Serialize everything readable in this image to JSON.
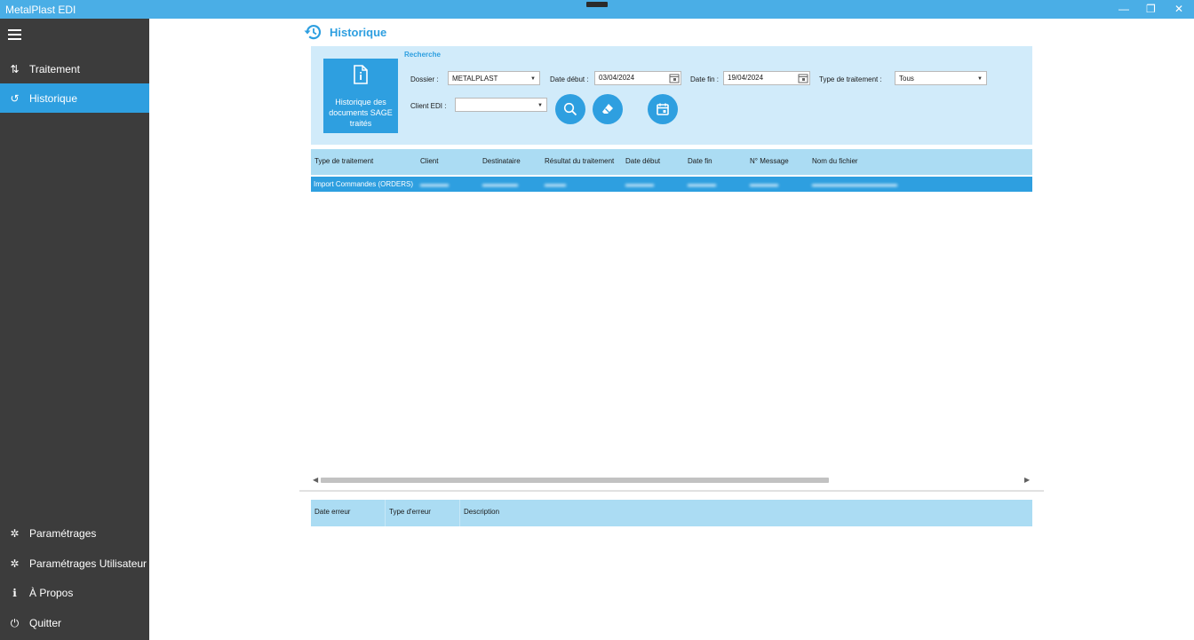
{
  "window": {
    "title": "MetalPlast EDI",
    "minimize_glyph": "—",
    "restore_glyph": "❐",
    "close_glyph": "✕"
  },
  "sidebar": {
    "menu_icon": "hamburger-icon",
    "items": [
      {
        "label": "Traitement",
        "icon": "sort-arrows-icon",
        "glyph": "⇅",
        "active": false
      },
      {
        "label": "Historique",
        "icon": "history-icon",
        "glyph": "↺",
        "active": true
      }
    ],
    "bottom_items": [
      {
        "label": "Paramétrages",
        "icon": "gear-icon",
        "glyph": "✲"
      },
      {
        "label": "Paramétrages Utilisateur",
        "icon": "gear-icon",
        "glyph": "✲"
      },
      {
        "label": "À Propos",
        "icon": "info-icon",
        "glyph": "ℹ"
      },
      {
        "label": "Quitter",
        "icon": "power-icon",
        "glyph": "⏻"
      }
    ],
    "colors": {
      "background": "#3c3c3c",
      "active": "#2e9fe0"
    }
  },
  "page": {
    "title": "Historique",
    "title_icon": "history-icon",
    "accent_color": "#2e9fe0"
  },
  "search": {
    "legend": "Recherche",
    "tile_label": "Historique des documents SAGE traités",
    "tile_icon": "document-info-icon",
    "dossier_label": "Dossier :",
    "dossier_value": "METALPLAST",
    "date_debut_label": "Date début :",
    "date_debut_value": "03/04/2024",
    "date_fin_label": "Date fin :",
    "date_fin_value": "19/04/2024",
    "type_label": "Type de traitement :",
    "type_value": "Tous",
    "client_label": "Client EDI :",
    "client_value": "",
    "buttons": [
      "search-icon",
      "eraser-icon",
      "calendar-icon"
    ]
  },
  "grid": {
    "columns": [
      "Type de traitement",
      "Client",
      "Destinataire",
      "Résultat du traitement",
      "Date début",
      "Date fin",
      "N° Message",
      "Nom du fichier"
    ],
    "rows": [
      {
        "type": "Import Commandes (ORDERS)",
        "selected": true
      }
    ]
  },
  "errors": {
    "columns": [
      "Date erreur",
      "Type d'erreur",
      "Description"
    ]
  }
}
